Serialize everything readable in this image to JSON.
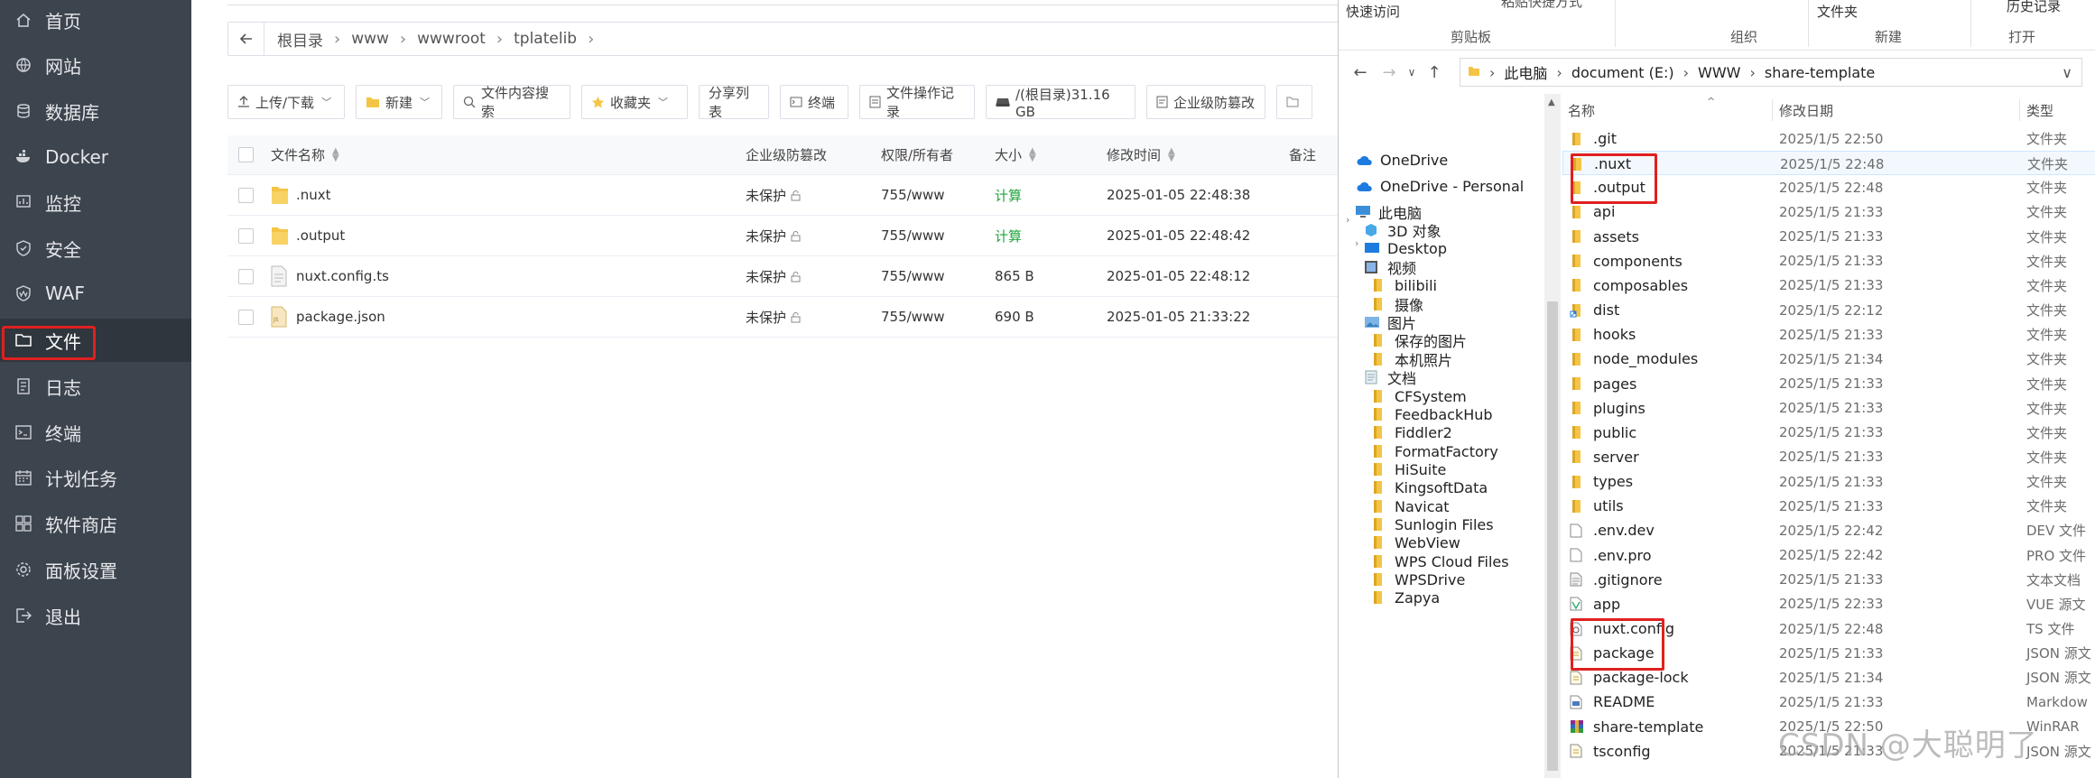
{
  "sidebar": {
    "items": [
      {
        "label": "首页",
        "icon": "home-icon"
      },
      {
        "label": "网站",
        "icon": "globe-icon"
      },
      {
        "label": "数据库",
        "icon": "database-icon"
      },
      {
        "label": "Docker",
        "icon": "docker-icon"
      },
      {
        "label": "监控",
        "icon": "monitor-icon"
      },
      {
        "label": "安全",
        "icon": "shield-icon"
      },
      {
        "label": "WAF",
        "icon": "waf-shield-icon"
      },
      {
        "label": "文件",
        "icon": "folder-icon",
        "active": true
      },
      {
        "label": "日志",
        "icon": "log-icon"
      },
      {
        "label": "终端",
        "icon": "terminal-icon"
      },
      {
        "label": "计划任务",
        "icon": "calendar-icon"
      },
      {
        "label": "软件商店",
        "icon": "grid-icon"
      },
      {
        "label": "面板设置",
        "icon": "gear-icon"
      },
      {
        "label": "退出",
        "icon": "logout-icon"
      }
    ]
  },
  "path": {
    "crumbs": [
      "根目录",
      "www",
      "wwwroot",
      "tplatelib"
    ]
  },
  "toolbar": {
    "upload": "上传/下载",
    "new": "新建",
    "search": "文件内容搜索",
    "favorites": "收藏夹",
    "share": "分享列表",
    "terminal": "终端",
    "oplog": "文件操作记录",
    "disk": "/(根目录)31.16 GB",
    "protect": "企业级防篡改"
  },
  "files": {
    "headers": {
      "name": "文件名称",
      "protect": "企业级防篡改",
      "perm": "权限/所有者",
      "size": "大小",
      "mtime": "修改时间",
      "note": "备注"
    },
    "rows": [
      {
        "name": ".nuxt",
        "type": "folder",
        "protect": "未保护",
        "perm": "755/www",
        "size": "计算",
        "mtime": "2025-01-05 22:48:38"
      },
      {
        "name": ".output",
        "type": "folder",
        "protect": "未保护",
        "perm": "755/www",
        "size": "计算",
        "mtime": "2025-01-05 22:48:42"
      },
      {
        "name": "nuxt.config.ts",
        "type": "file",
        "protect": "未保护",
        "perm": "755/www",
        "size": "865 B",
        "mtime": "2025-01-05 22:48:12"
      },
      {
        "name": "package.json",
        "type": "json",
        "protect": "未保护",
        "perm": "755/www",
        "size": "690 B",
        "mtime": "2025-01-05 21:33:22"
      }
    ]
  },
  "explorer": {
    "ribbon": {
      "quick_access": "快速访问",
      "paste_shortcut": "粘贴快捷方式",
      "clipboard": "剪贴板",
      "organize": "组织",
      "file": "文件夹",
      "new": "新建",
      "history": "历史记录",
      "open": "打开"
    },
    "address": [
      "此电脑",
      "document (E:)",
      "WWW",
      "share-template"
    ],
    "nav": [
      {
        "label": "OneDrive",
        "icon": "cloud-icon",
        "indent": 0
      },
      {
        "label": "OneDrive - Personal",
        "icon": "cloud-icon",
        "indent": 0
      },
      {
        "label": "此电脑",
        "icon": "pc-icon",
        "indent": 0
      },
      {
        "label": "3D 对象",
        "icon": "3d-objects-icon",
        "indent": 1
      },
      {
        "label": "Desktop",
        "icon": "desktop-icon",
        "indent": 1
      },
      {
        "label": "视频",
        "icon": "video-icon",
        "indent": 1
      },
      {
        "label": "bilibili",
        "icon": "folder-icon",
        "indent": 2
      },
      {
        "label": "摄像",
        "icon": "folder-icon",
        "indent": 2
      },
      {
        "label": "图片",
        "icon": "pictures-icon",
        "indent": 1
      },
      {
        "label": "保存的图片",
        "icon": "folder-icon",
        "indent": 2
      },
      {
        "label": "本机照片",
        "icon": "folder-icon",
        "indent": 2
      },
      {
        "label": "文档",
        "icon": "documents-icon",
        "indent": 1
      },
      {
        "label": "CFSystem",
        "icon": "folder-icon",
        "indent": 2
      },
      {
        "label": "FeedbackHub",
        "icon": "folder-icon",
        "indent": 2
      },
      {
        "label": "Fiddler2",
        "icon": "folder-icon",
        "indent": 2
      },
      {
        "label": "FormatFactory",
        "icon": "folder-icon",
        "indent": 2
      },
      {
        "label": "HiSuite",
        "icon": "folder-icon",
        "indent": 2
      },
      {
        "label": "KingsoftData",
        "icon": "folder-icon",
        "indent": 2
      },
      {
        "label": "Navicat",
        "icon": "folder-icon",
        "indent": 2
      },
      {
        "label": "Sunlogin Files",
        "icon": "folder-icon",
        "indent": 2
      },
      {
        "label": "WebView",
        "icon": "folder-icon",
        "indent": 2
      },
      {
        "label": "WPS Cloud Files",
        "icon": "folder-icon",
        "indent": 2
      },
      {
        "label": "WPSDrive",
        "icon": "folder-icon",
        "indent": 2
      },
      {
        "label": "Zapya",
        "icon": "folder-icon",
        "indent": 2
      }
    ],
    "headers": {
      "name": "名称",
      "date": "修改日期",
      "type": "类型"
    },
    "items": [
      {
        "name": ".git",
        "date": "2025/1/5 22:50",
        "type": "文件夹",
        "icon": "folder"
      },
      {
        "name": ".nuxt",
        "date": "2025/1/5 22:48",
        "type": "文件夹",
        "icon": "folder"
      },
      {
        "name": ".output",
        "date": "2025/1/5 22:48",
        "type": "文件夹",
        "icon": "folder"
      },
      {
        "name": "api",
        "date": "2025/1/5 21:33",
        "type": "文件夹",
        "icon": "folder"
      },
      {
        "name": "assets",
        "date": "2025/1/5 21:33",
        "type": "文件夹",
        "icon": "folder"
      },
      {
        "name": "components",
        "date": "2025/1/5 21:33",
        "type": "文件夹",
        "icon": "folder"
      },
      {
        "name": "composables",
        "date": "2025/1/5 21:33",
        "type": "文件夹",
        "icon": "folder"
      },
      {
        "name": "dist",
        "date": "2025/1/5 22:12",
        "type": "文件夹",
        "icon": "shortcut"
      },
      {
        "name": "hooks",
        "date": "2025/1/5 21:33",
        "type": "文件夹",
        "icon": "folder"
      },
      {
        "name": "node_modules",
        "date": "2025/1/5 21:34",
        "type": "文件夹",
        "icon": "folder"
      },
      {
        "name": "pages",
        "date": "2025/1/5 21:33",
        "type": "文件夹",
        "icon": "folder"
      },
      {
        "name": "plugins",
        "date": "2025/1/5 21:33",
        "type": "文件夹",
        "icon": "folder"
      },
      {
        "name": "public",
        "date": "2025/1/5 21:33",
        "type": "文件夹",
        "icon": "folder"
      },
      {
        "name": "server",
        "date": "2025/1/5 21:33",
        "type": "文件夹",
        "icon": "folder"
      },
      {
        "name": "types",
        "date": "2025/1/5 21:33",
        "type": "文件夹",
        "icon": "folder"
      },
      {
        "name": "utils",
        "date": "2025/1/5 21:33",
        "type": "文件夹",
        "icon": "folder"
      },
      {
        "name": ".env.dev",
        "date": "2025/1/5 22:42",
        "type": "DEV 文件",
        "icon": "file"
      },
      {
        "name": ".env.pro",
        "date": "2025/1/5 22:42",
        "type": "PRO 文件",
        "icon": "file"
      },
      {
        "name": ".gitignore",
        "date": "2025/1/5 21:33",
        "type": "文本文档",
        "icon": "text"
      },
      {
        "name": "app",
        "date": "2025/1/5 22:33",
        "type": "VUE 源文",
        "icon": "vue"
      },
      {
        "name": "nuxt.config",
        "date": "2025/1/5 22:48",
        "type": "TS 文件",
        "icon": "ts"
      },
      {
        "name": "package",
        "date": "2025/1/5 21:33",
        "type": "JSON 源文",
        "icon": "json"
      },
      {
        "name": "package-lock",
        "date": "2025/1/5 21:34",
        "type": "JSON 源文",
        "icon": "json"
      },
      {
        "name": "README",
        "date": "2025/1/5 21:33",
        "type": "Markdow",
        "icon": "md"
      },
      {
        "name": "share-template",
        "date": "2025/1/5 22:50",
        "type": "WinRAR",
        "icon": "rar"
      },
      {
        "name": "tsconfig",
        "date": "2025/1/5 21:33",
        "type": "JSON 源文",
        "icon": "json"
      }
    ]
  },
  "watermark": "CSDN @大聪明了",
  "colors": {
    "sidebar_bg": "#3c444d",
    "highlight": "#e02020",
    "green": "#20a53a",
    "folder": "#f4c545"
  }
}
